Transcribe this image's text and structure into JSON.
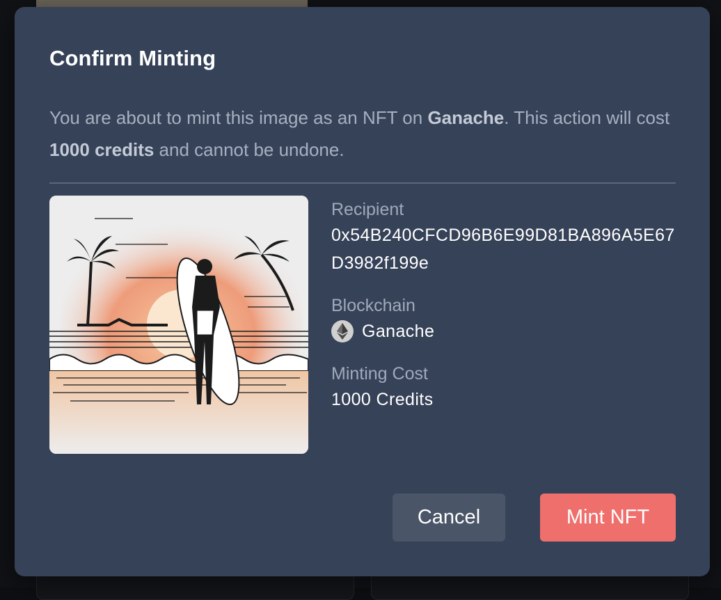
{
  "dialog": {
    "title": "Confirm Minting",
    "description": {
      "part1": "You are about to mint this image as an NFT on ",
      "network": "Ganache",
      "part2": ". This action will cost ",
      "cost": "1000 credits",
      "part3": " and cannot be undone."
    },
    "image": {
      "icon": "surfer-at-sunset-artwork"
    },
    "recipient": {
      "label": "Recipient",
      "value": "0x54B240CFCD96B6E99D81BA896A5E67D3982f199e"
    },
    "blockchain": {
      "label": "Blockchain",
      "value": "Ganache",
      "icon": "ethereum-icon"
    },
    "minting_cost": {
      "label": "Minting Cost",
      "value": "1000 Credits"
    },
    "buttons": {
      "cancel": "Cancel",
      "mint": "Mint NFT"
    },
    "colors": {
      "modal_bg": "#364258",
      "mint_button": "#ef6f6c",
      "cancel_button": "#4b5568"
    }
  }
}
